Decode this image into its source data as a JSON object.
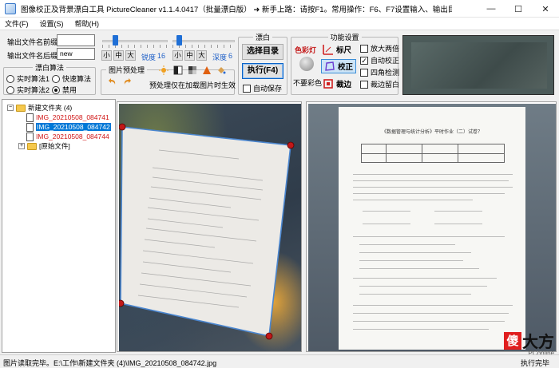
{
  "window": {
    "title": "图像校正及背景漂白工具 PictureCleaner v1.1.4.0417（批量漂白版）  ➜ 新手上路：请按F1。常用操作：F6、F7设置输入、输出目录。单击图片执行漂白，目录名...",
    "minimize": "—",
    "maximize": "☐",
    "close": "✕"
  },
  "menu": [
    "文件(F)",
    "设置(S)",
    "帮助(H)"
  ],
  "output": {
    "prefix_label": "输出文件名前缀",
    "prefix_value": "",
    "suffix_label": "输出文件名后缀",
    "suffix_value": "new"
  },
  "algorithm": {
    "title": "漂白算法",
    "options": [
      "实时算法1",
      "快速算法",
      "实时算法2",
      "禁用"
    ],
    "selected": "禁用"
  },
  "sliders": {
    "sharpness": {
      "label": "锐度",
      "value": "16",
      "buttons": [
        "小",
        "中",
        "大"
      ],
      "level": 0.2
    },
    "depth": {
      "label": "深度",
      "value": "6",
      "buttons": [
        "小",
        "中",
        "大"
      ],
      "level": 0.6
    }
  },
  "preprocess": {
    "title": "图片预处理",
    "note": "预处理仅在加载图片时生效"
  },
  "bleach": {
    "title": "漂白",
    "select_dir": "选择目录",
    "execute": "执行(F4)",
    "auto_save": "自动保存",
    "auto_save_checked": false
  },
  "features": {
    "title": "功能设置",
    "color_label": "色彩灯",
    "no_color_label": "不要彩色",
    "ruler": "标尺",
    "correct": "校正",
    "crop": "裁边",
    "options": [
      {
        "label": "放大两倍",
        "checked": false
      },
      {
        "label": "自动校正",
        "checked": true
      },
      {
        "label": "四角检测",
        "checked": false
      },
      {
        "label": "裁边留白",
        "checked": false
      }
    ]
  },
  "tree": {
    "root": "新建文件夹 (4)",
    "files": [
      "IMG_20210508_084741",
      "IMG_20210508_084742",
      "IMG_20210508_084744"
    ],
    "selected_index": 1,
    "sub": "[原始文件]"
  },
  "document": {
    "heading": "《数据管理与统计分析》平时作业（二）试卷？"
  },
  "status": {
    "left": "图片读取完毕。E:\\工作\\新建文件夹 (4)\\IMG_20210508_084742.jpg",
    "right": "执行完毕"
  },
  "watermark": {
    "box": "傻",
    "text": "大方",
    "small": "PConline"
  }
}
